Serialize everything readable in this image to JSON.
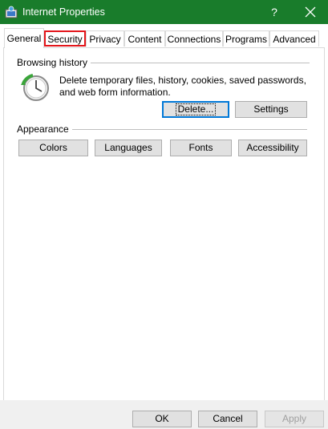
{
  "window": {
    "title": "Internet Properties",
    "help_glyph": "?",
    "close_glyph": "✕"
  },
  "tabs": [
    {
      "label": "General"
    },
    {
      "label": "Security"
    },
    {
      "label": "Privacy"
    },
    {
      "label": "Content"
    },
    {
      "label": "Connections"
    },
    {
      "label": "Programs"
    },
    {
      "label": "Advanced"
    }
  ],
  "browsing_history": {
    "heading": "Browsing history",
    "description": "Delete temporary files, history, cookies, saved passwords, and web form information.",
    "delete_label": "Delete...",
    "settings_label": "Settings"
  },
  "appearance": {
    "heading": "Appearance",
    "colors_label": "Colors",
    "languages_label": "Languages",
    "fonts_label": "Fonts",
    "accessibility_label": "Accessibility"
  },
  "footer": {
    "ok_label": "OK",
    "cancel_label": "Cancel",
    "apply_label": "Apply"
  },
  "colors": {
    "titlebar": "#197c2b",
    "highlight_outline": "#e3151a"
  }
}
